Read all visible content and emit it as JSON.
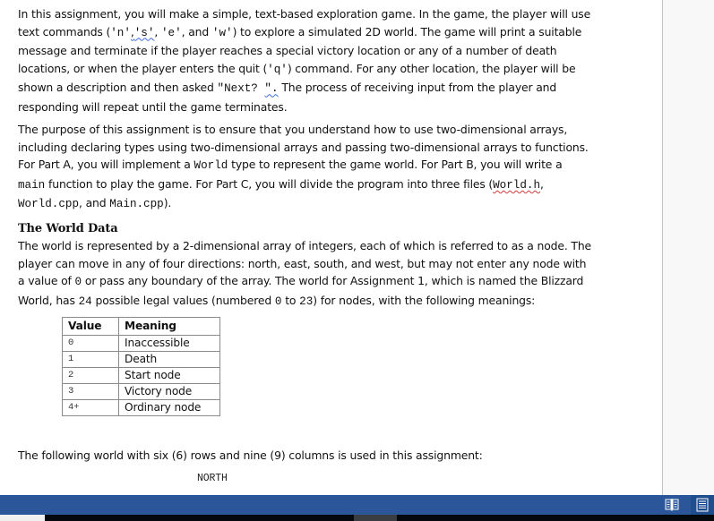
{
  "document": {
    "paragraph1": {
      "t1": "In this assignment, you will make a simple, text-based exploration game.  In the game, the player will use text commands (",
      "cmd_n": "'n'",
      "sep1": ",",
      "cmd_s": "'s'",
      "sep2": ", ",
      "cmd_e": "'e'",
      "sep3": ", and ",
      "cmd_w": "'w'",
      "t2": ") to explore a simulated 2D world.  The game will print a suitable message and terminate if the player reaches a special victory location or any of a number of death locations, or when the player enters the quit (",
      "cmd_q": "'q'",
      "t3": ") command.  For any other location, the player will be shown a description and then asked ",
      "prompt": "\"Next? ",
      "prompt_end": "\".",
      "t4": " The process of receiving input from the player and responding will repeat until the game terminates."
    },
    "paragraph2": {
      "t1": "The purpose of this assignment is to ensure that you understand how to use two-dimensional arrays, including declaring types using two-dimensional arrays and passing two-dimensional arrays to functions. For Part A, you will implement a ",
      "world_type": "World",
      "t2": " type to represent the game world.  For Part B, you will write a ",
      "main_fn": "main",
      "t3": " function to play the game.  For Part C, you will divide the program into three files (",
      "file1": "World.h",
      "t4": ", ",
      "file2": "World.cpp",
      "t5": ", and ",
      "file3": "Main.cpp",
      "t6": ")."
    },
    "heading": "The World Data",
    "paragraph3": {
      "t1": "The world is represented by a 2-dimensional array of integers, each of which is referred to as a node. The player can move in any of four directions: north, east, south, and west, but may not enter any node with a value of ",
      "zero": "0",
      "t2": " or pass any boundary of the array.  The world for Assignment 1, which is named the Blizzard World, has ",
      "count": "24",
      "t3": " possible legal values (numbered ",
      "lo": "0",
      "t4": " to ",
      "hi": "23",
      "t5": ") for nodes, with the following meanings:"
    },
    "table": {
      "headers": [
        "Value",
        "Meaning"
      ],
      "rows": [
        {
          "value": "0",
          "meaning": "Inaccessible"
        },
        {
          "value": "1",
          "meaning": "Death"
        },
        {
          "value": "2",
          "meaning": "Start node"
        },
        {
          "value": "3",
          "meaning": "Victory node"
        },
        {
          "value": "4+",
          "meaning": "Ordinary node"
        }
      ]
    },
    "paragraph4": "The following world with six (6) rows and nine (9) columns is used in this assignment:",
    "map_label_north": "NORTH"
  },
  "statusbar": {
    "color": "#2b579a",
    "icons": [
      "read-mode-icon",
      "print-layout-icon"
    ]
  }
}
